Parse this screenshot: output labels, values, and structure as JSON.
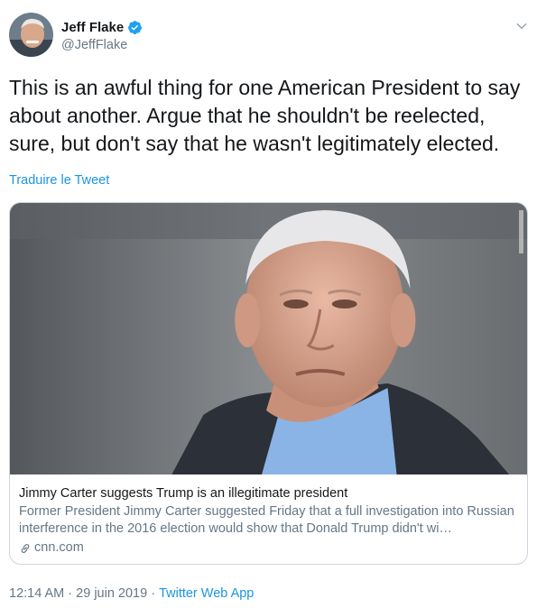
{
  "author": {
    "name": "Jeff Flake",
    "handle": "@JeffFlake",
    "verified": true,
    "verified_icon": "verified-badge-icon",
    "avatar_icon": "avatar-photo"
  },
  "tweet": {
    "text": "This is an awful thing for one American President to say about another. Argue that he shouldn't be reelected, sure, but don't say that he wasn't legitimately elected.",
    "translate_label": "Traduire le Tweet"
  },
  "card": {
    "title": "Jimmy Carter suggests Trump is an illegitimate president",
    "description": "Former President Jimmy Carter suggested Friday that a full investigation into Russian interference in the 2016 election would show that Donald Trump didn't wi…",
    "domain": "cnn.com",
    "link_icon": "link-icon"
  },
  "meta": {
    "time": "12:14 AM",
    "separator1": " · ",
    "date": "29 juin 2019",
    "separator2": " · ",
    "app": "Twitter Web App"
  },
  "colors": {
    "accent": "#1b95e0",
    "text": "#14171a",
    "secondary": "#657786",
    "border": "#ccd6dd"
  }
}
